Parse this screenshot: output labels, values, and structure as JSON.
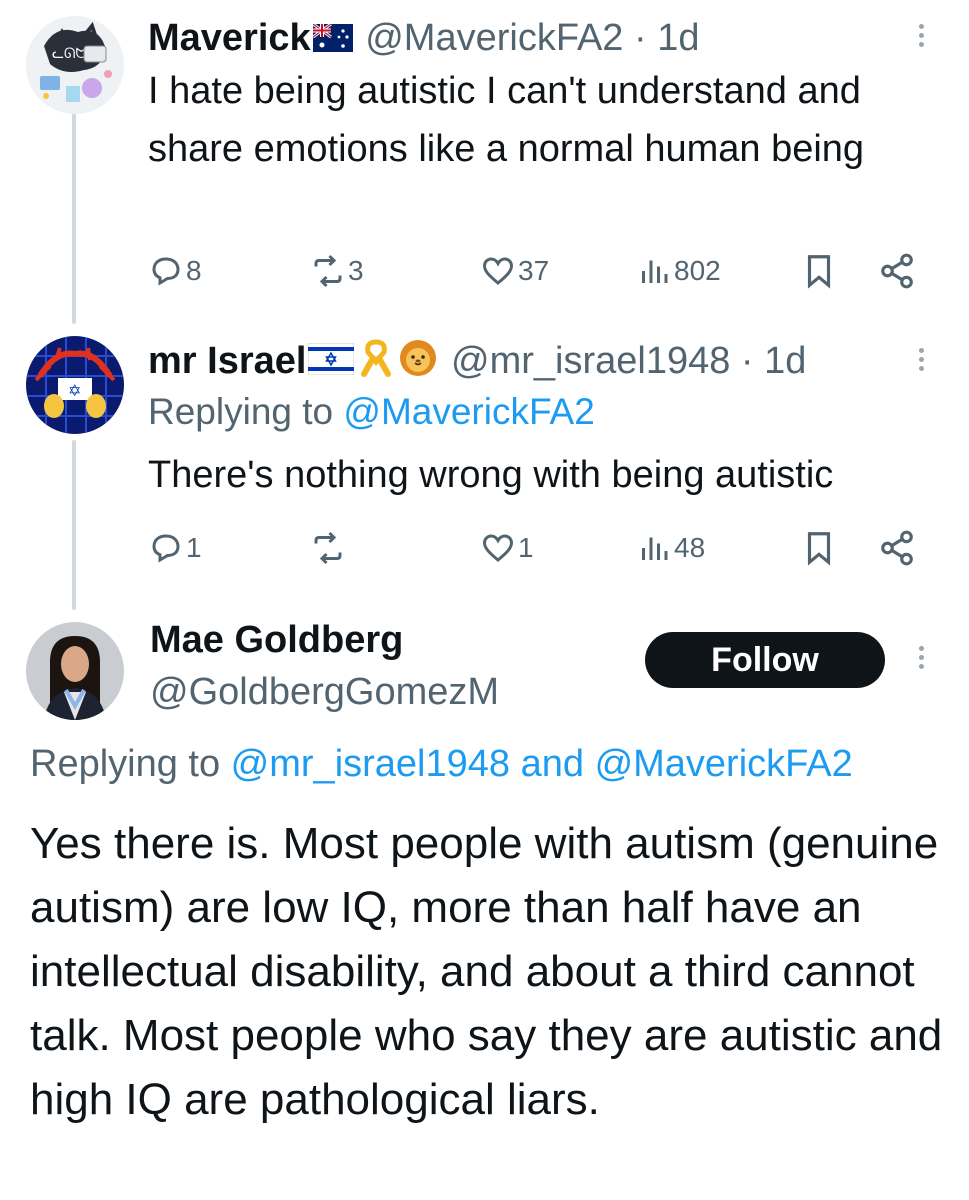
{
  "colors": {
    "text": "#0f1419",
    "secondary": "#536471",
    "link": "#1d9bf0",
    "thread_line": "#cfd9de",
    "button_bg": "#0f1419"
  },
  "tweets": [
    {
      "name": "Maverick",
      "flag": "australia-flag",
      "handle": "@MaverickFA2 · 1d",
      "text": "I hate being autistic I can't understand and share emotions like a normal human being",
      "stats": {
        "replies": "8",
        "reposts": "3",
        "likes": "37",
        "views": "802"
      }
    },
    {
      "name": "mr Israel",
      "flag": "israel-flag",
      "badges": [
        "yellow-ribbon-emoji",
        "lion-emoji"
      ],
      "handle": "@mr_israel1948 · 1d",
      "replying_label": "Replying to ",
      "replying_to": "@MaverickFA2",
      "text": "There's nothing wrong with being autistic",
      "stats": {
        "replies": "1",
        "reposts": "",
        "likes": "1",
        "views": "48"
      }
    },
    {
      "name": "Mae Goldberg",
      "handle": "@GoldbergGomezM",
      "follow_label": "Follow",
      "replying_label": "Replying to ",
      "replying_to_1": "@mr_israel1948",
      "replying_and": " and ",
      "replying_to_2": "@MaverickFA2",
      "text": "Yes there is. Most people with autism (genuine autism) are low IQ, more than half have an intellectual disability, and about a third cannot talk. Most people who say they are autistic and high IQ are pathological liars."
    }
  ]
}
